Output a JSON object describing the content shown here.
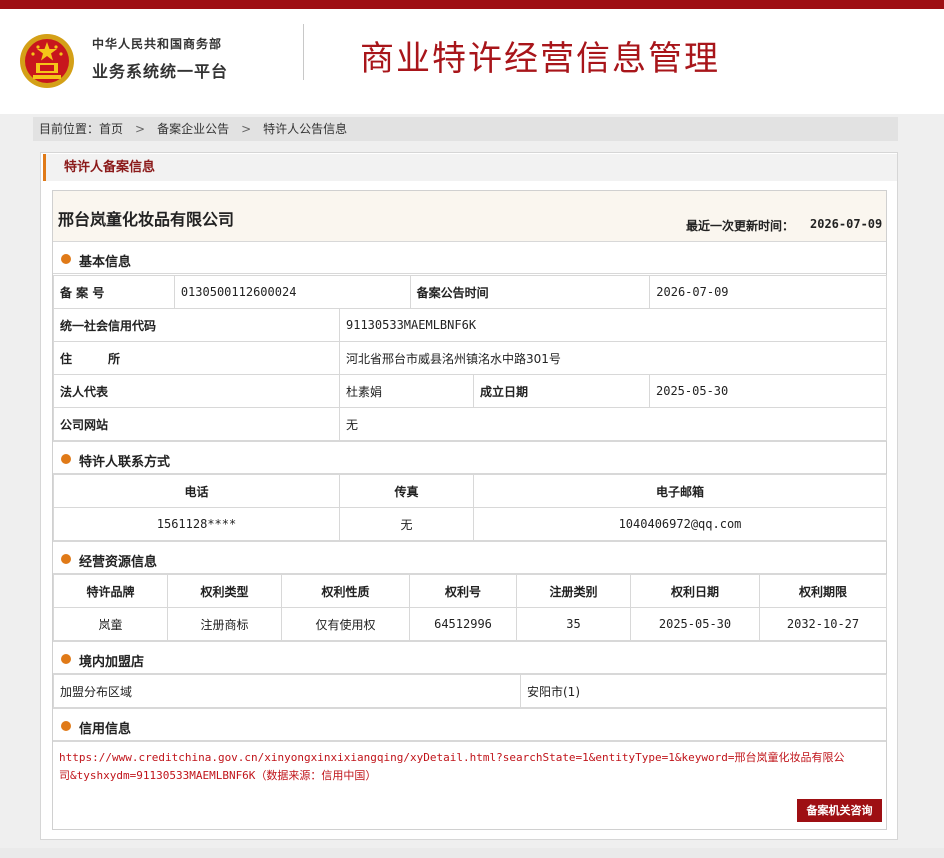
{
  "header": {
    "ministry": "中华人民共和国商务部",
    "platform": "业务系统统一平台",
    "system_title": "商业特许经营信息管理"
  },
  "breadcrumb": {
    "prefix": "目前位置：",
    "items": [
      "首页",
      "备案企业公告",
      "特许人公告信息"
    ],
    "separator": ">"
  },
  "section_title": "特许人备案信息",
  "company": {
    "name": "邢台岚童化妆品有限公司",
    "update_label": "最近一次更新时间：",
    "update_value": "2026-07-09"
  },
  "basic_info": {
    "title": "基本信息",
    "filing_no_label": "备 案 号",
    "filing_no": "0130500112600024",
    "announce_time_label": "备案公告时间",
    "announce_time": "2026-07-09",
    "credit_code_label": "统一社会信用代码",
    "credit_code": "91130533MAEMLBNF6K",
    "address_label": "住　　　所",
    "address": "河北省邢台市威县洺州镇洺水中路301号",
    "legal_rep_label": "法人代表",
    "legal_rep": "杜素娟",
    "established_label": "成立日期",
    "established": "2025-05-30",
    "website_label": "公司网站",
    "website": "无"
  },
  "contact": {
    "title": "特许人联系方式",
    "headers": [
      "电话",
      "传真",
      "电子邮箱"
    ],
    "phone": "1561128****",
    "fax": "无",
    "email": "1040406972@qq.com"
  },
  "resources": {
    "title": "经营资源信息",
    "headers": [
      "特许品牌",
      "权利类型",
      "权利性质",
      "权利号",
      "注册类别",
      "权利日期",
      "权利期限"
    ],
    "row": [
      "岚童",
      "注册商标",
      "仅有使用权",
      "64512996",
      "35",
      "2025-05-30",
      "2032-10-27"
    ]
  },
  "franchise": {
    "title": "境内加盟店",
    "area_label": "加盟分布区域",
    "area_value": "安阳市(1)"
  },
  "credit": {
    "title": "信用信息",
    "link": "https://www.creditchina.gov.cn/xinyongxinxixiangqing/xyDetail.html?searchState=1&entityType=1&keyword=邢台岚童化妆品有限公司&tyshxydm=91130533MAEMLBNF6K",
    "source": "（数据来源：信用中国）"
  },
  "consult_button": "备案机关咨询",
  "colors": {
    "brand_red": "#9e0f13",
    "title_red": "#a8151a",
    "accent_orange": "#e07a18"
  }
}
